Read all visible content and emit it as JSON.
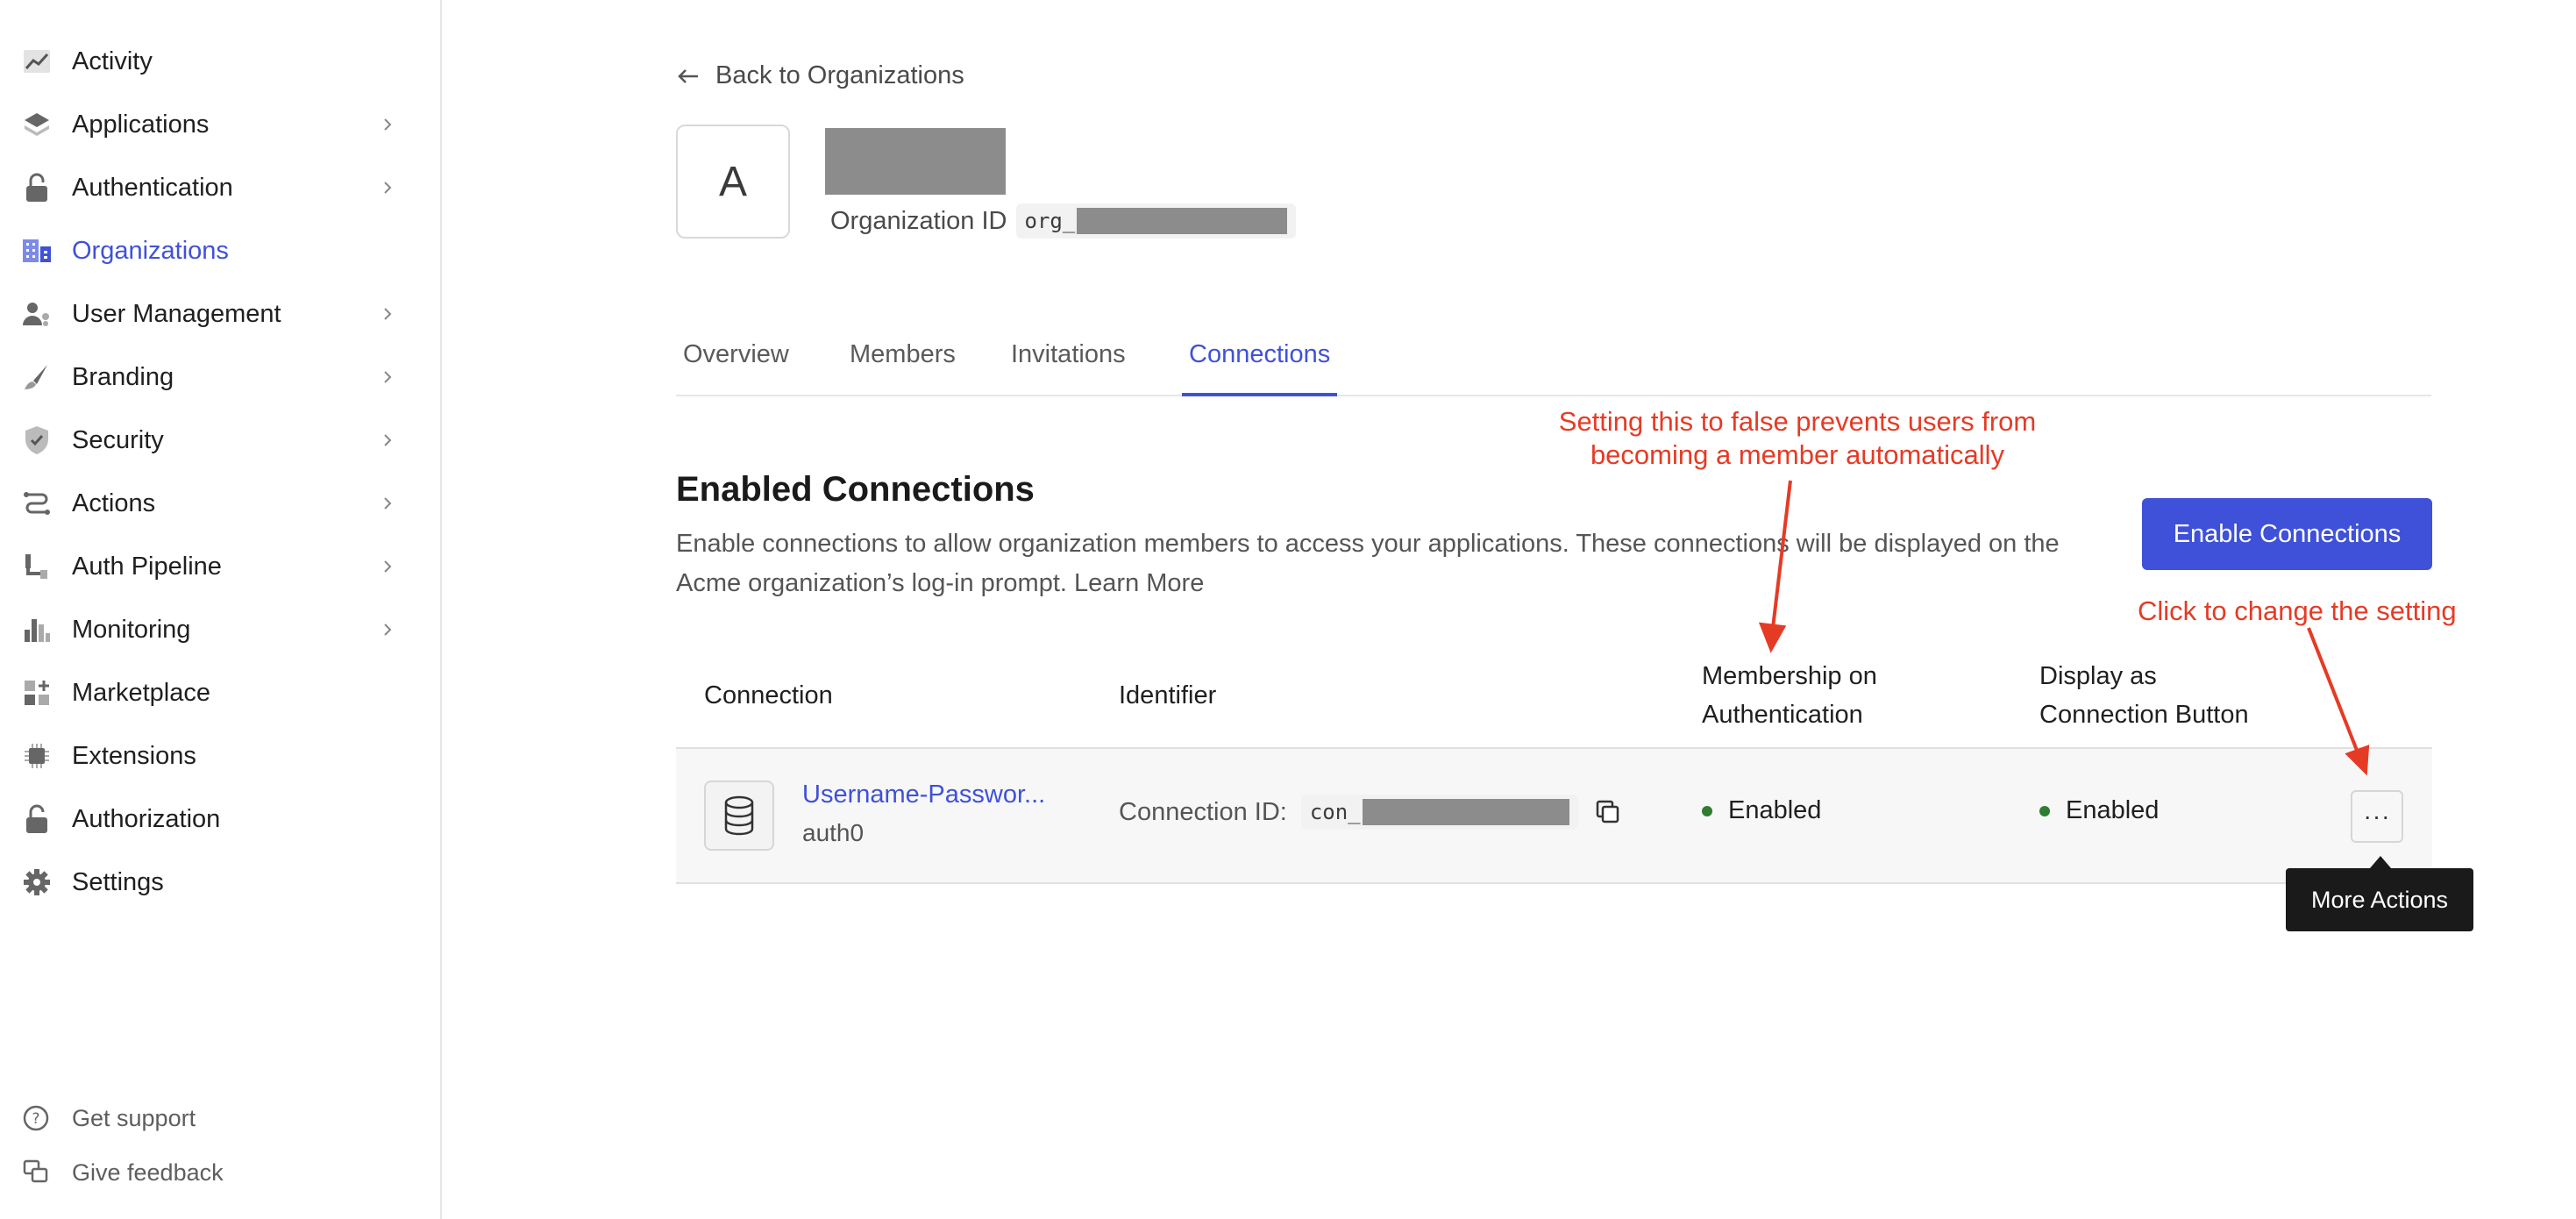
{
  "sidebar": {
    "items": [
      {
        "label": "Activity",
        "icon": "activity-chart-icon",
        "has_chevron": false,
        "active": false
      },
      {
        "label": "Applications",
        "icon": "layers-icon",
        "has_chevron": true,
        "active": false
      },
      {
        "label": "Authentication",
        "icon": "lock-icon",
        "has_chevron": true,
        "active": false
      },
      {
        "label": "Organizations",
        "icon": "organizations-building-icon",
        "has_chevron": false,
        "active": true
      },
      {
        "label": "User Management",
        "icon": "user-management-icon",
        "has_chevron": true,
        "active": false
      },
      {
        "label": "Branding",
        "icon": "brush-icon",
        "has_chevron": true,
        "active": false
      },
      {
        "label": "Security",
        "icon": "shield-check-icon",
        "has_chevron": true,
        "active": false
      },
      {
        "label": "Actions",
        "icon": "actions-flow-icon",
        "has_chevron": true,
        "active": false
      },
      {
        "label": "Auth Pipeline",
        "icon": "pipeline-icon",
        "has_chevron": true,
        "active": false
      },
      {
        "label": "Monitoring",
        "icon": "bar-chart-icon",
        "has_chevron": true,
        "active": false
      },
      {
        "label": "Marketplace",
        "icon": "marketplace-grid-icon",
        "has_chevron": false,
        "active": false
      },
      {
        "label": "Extensions",
        "icon": "chip-icon",
        "has_chevron": false,
        "active": false
      },
      {
        "label": "Authorization",
        "icon": "unlock-icon",
        "has_chevron": false,
        "active": false
      },
      {
        "label": "Settings",
        "icon": "gear-icon",
        "has_chevron": false,
        "active": false
      }
    ],
    "footer": [
      {
        "label": "Get support",
        "icon": "help-circle-icon"
      },
      {
        "label": "Give feedback",
        "icon": "feedback-icon"
      }
    ]
  },
  "header": {
    "back_label": "Back to Organizations",
    "avatar_letter": "A",
    "org_id_label": "Organization ID",
    "org_id_prefix": "org_"
  },
  "tabs": [
    "Overview",
    "Members",
    "Invitations",
    "Connections"
  ],
  "active_tab": "Connections",
  "section": {
    "title": "Enabled Connections",
    "description": "Enable connections to allow organization members to access your applications. These connections will be displayed on the Acme organization’s log-in prompt.",
    "learn_more": "Learn More",
    "enable_button": "Enable Connections"
  },
  "table": {
    "headers": {
      "connection": "Connection",
      "identifier": "Identifier",
      "membership_line1": "Membership on",
      "membership_line2": "Authentication",
      "display_line1": "Display as",
      "display_line2": "Connection Button"
    },
    "rows": [
      {
        "name": "Username-Passwor...",
        "strategy": "auth0",
        "identifier_label": "Connection ID:",
        "identifier_prefix": "con_",
        "membership": "Enabled",
        "display": "Enabled",
        "more_label": "···"
      }
    ]
  },
  "tooltip": "More Actions",
  "annotations": {
    "membership_line1": "Setting this to false prevents users from",
    "membership_line2": "becoming a member automatically",
    "more_actions": "Click to change the setting"
  },
  "colors": {
    "accent": "#3f51d8",
    "annotation": "#e53b25",
    "status_enabled": "#2e7d32",
    "redaction": "#8c8c8c"
  }
}
